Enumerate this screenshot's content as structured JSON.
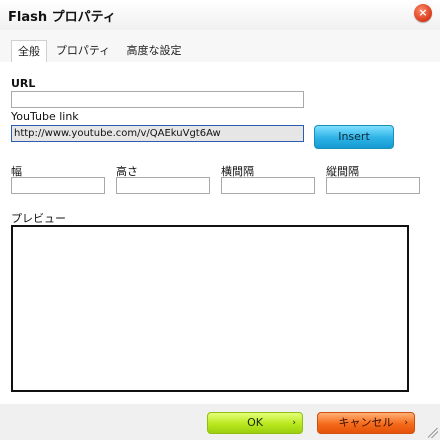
{
  "dialog": {
    "title": "Flash プロパティ",
    "close_symbol": "×"
  },
  "tabs": [
    {
      "label": "全般",
      "active": true
    },
    {
      "label": "プロパティ",
      "active": false
    },
    {
      "label": "高度な設定",
      "active": false
    }
  ],
  "form": {
    "url_label": "URL",
    "url_value": "",
    "youtube_label": "YouTube link",
    "youtube_value": "http://www.youtube.com/v/QAEkuVgt6Aw",
    "insert_label": "Insert",
    "width_label": "幅",
    "width_value": "",
    "height_label": "高さ",
    "height_value": "",
    "hspace_label": "横間隔",
    "hspace_value": "",
    "vspace_label": "縦間隔",
    "vspace_value": "",
    "preview_label": "プレビュー"
  },
  "footer": {
    "ok_label": "OK",
    "cancel_label": "キャンセル",
    "arrow_symbol": "›"
  },
  "colors": {
    "ok_button": "#b8e81e",
    "cancel_button": "#f56a1a",
    "insert_button": "#2cb2e6",
    "close_button": "#d83a1a"
  },
  "icons": {
    "close": "close-icon",
    "resize": "resize-grip-icon"
  }
}
